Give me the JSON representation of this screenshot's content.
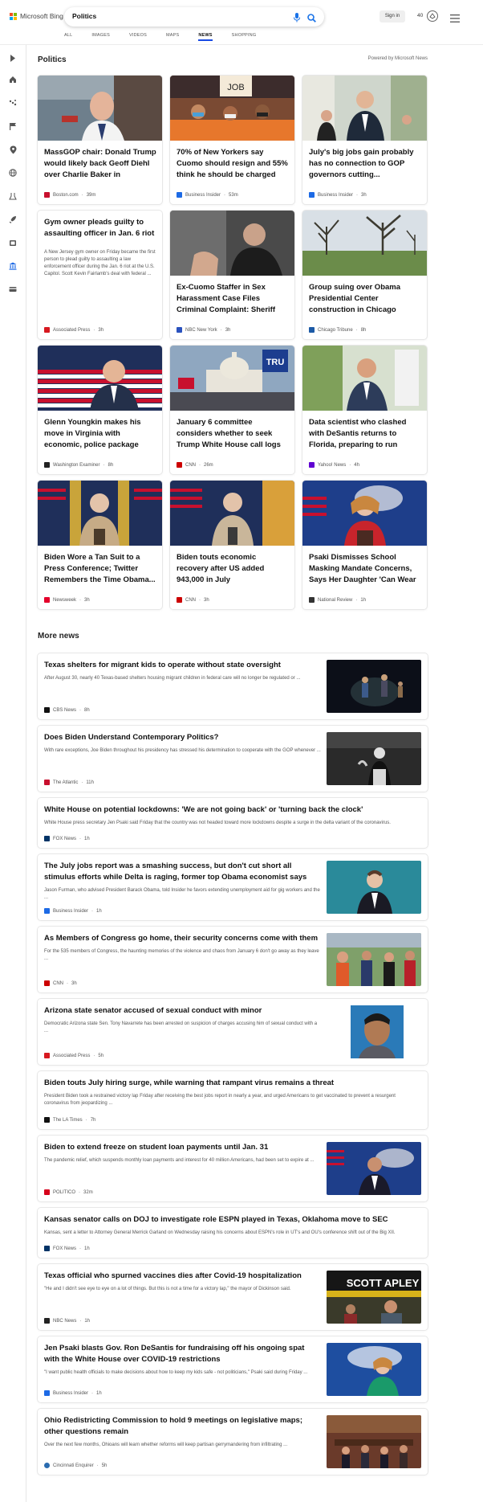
{
  "header": {
    "logo_text": "Microsoft Bing",
    "logo_colors": [
      "#f25022",
      "#7fba00",
      "#00a4ef",
      "#ffb900"
    ],
    "query": "Politics",
    "signin_label": "Sign in",
    "points": "40"
  },
  "tabs": [
    "ALL",
    "IMAGES",
    "VIDEOS",
    "MAPS",
    "NEWS",
    "SHOPPING"
  ],
  "active_tab": "NEWS",
  "sidebar_icons": [
    "chevron-right-icon",
    "home-icon",
    "sports-icon",
    "flag-icon",
    "location-pin-icon",
    "globe-icon",
    "science-icon",
    "rocket-icon",
    "entertainment-icon",
    "government-icon",
    "money-icon"
  ],
  "section": {
    "title": "Politics",
    "powered_by": "Powered by Microsoft News"
  },
  "cards": [
    {
      "title": "MassGOP chair: Donald Trump would likely back Geoff Diehl over Charlie Baker in governo...",
      "source": "Boston.com",
      "time": "39m",
      "src_color": "#c8102e",
      "has_image": true
    },
    {
      "title": "70% of New Yorkers say Cuomo should resign and 55% think he should be charged with a crim...",
      "source": "Business Insider",
      "time": "53m",
      "src_color": "#1d6ae5",
      "has_image": true
    },
    {
      "title": "July's big jobs gain probably has no connection to GOP governors cutting...",
      "source": "Business Insider",
      "time": "3h",
      "src_color": "#1d6ae5",
      "has_image": true
    },
    {
      "title": "Gym owner pleads guilty to assaulting officer in Jan. 6 riot",
      "snippet": "A New Jersey gym owner on Friday became the first person to plead guilty to assaulting a law enforcement officer during the Jan. 6 riot at the U.S. Capitol. Scott Kevin Fairlamb's deal with federal ...",
      "source": "Associated Press",
      "time": "3h",
      "src_color": "#d71920",
      "has_image": false
    },
    {
      "title": "Ex-Cuomo Staffer in Sex Harassment Case Files Criminal Complaint: Sheriff",
      "source": "NBC New York",
      "time": "3h",
      "src_color": "#2a52be",
      "has_image": true
    },
    {
      "title": "Group suing over Obama Presidential Center construction in Chicago dealt...",
      "source": "Chicago Tribune",
      "time": "8h",
      "src_color": "#1c5aa6",
      "has_image": true
    },
    {
      "title": "Glenn Youngkin makes his move in Virginia with economic, police package",
      "source": "Washington Examiner",
      "time": "8h",
      "src_color": "#222222",
      "has_image": true
    },
    {
      "title": "January 6 committee considers whether to seek Trump White House call logs as investigato...",
      "source": "CNN",
      "time": "26m",
      "src_color": "#cc0000",
      "has_image": true
    },
    {
      "title": "Data scientist who clashed with DeSantis returns to Florida, preparing to run against Matt...",
      "source": "Yahoo! News",
      "time": "4h",
      "src_color": "#6001d2",
      "has_image": true
    },
    {
      "title": "Biden Wore a Tan Suit to a Press Conference; Twitter Remembers the Time Obama...",
      "source": "Newsweek",
      "time": "3h",
      "src_color": "#e4002b",
      "has_image": true
    },
    {
      "title": "Biden touts economic recovery after US added 943,000 in July",
      "source": "CNN",
      "time": "3h",
      "src_color": "#cc0000",
      "has_image": true
    },
    {
      "title": "Psaki Dismisses School Masking Mandate Concerns, Says Her Daughter 'Can Wear ...",
      "source": "National Review",
      "time": "1h",
      "src_color": "#333333",
      "has_image": true
    }
  ],
  "more_news_title": "More news",
  "news": [
    {
      "title": "Texas shelters for migrant kids to operate without state oversight",
      "snippet": "After August 30, nearly 40 Texas-based shelters housing migrant children in federal care will no longer be regulated or ...",
      "source": "CBS News",
      "time": "8h",
      "src_color": "#111111",
      "thumb": "night"
    },
    {
      "title": "Does Biden Understand Contemporary Politics?",
      "snippet": "With rare exceptions, Joe Biden throughout his presidency has stressed his determination to cooperate with the GOP whenever ...",
      "source": "The Atlantic",
      "time": "11h",
      "src_color": "#c8102e",
      "thumb": "bw"
    },
    {
      "title": "White House on potential lockdowns: 'We are not going back' or 'turning back the clock'",
      "snippet": "White House press secretary Jen Psaki said Friday that the country was not headed toward more lockdowns despite a surge in the delta variant of the coronavirus.",
      "source": "FOX News",
      "time": "1h",
      "src_color": "#003366",
      "thumb": ""
    },
    {
      "title": "The July jobs report was a smashing success, but don't cut short all stimulus efforts while Delta is raging, former top Obama economist says",
      "snippet": "Jason Furman, who advised President Barack Obama, told Insider he favors extending unemployment aid for gig workers and the ...",
      "source": "Business Insider",
      "time": "1h",
      "src_color": "#1d6ae5",
      "thumb": "teal"
    },
    {
      "title": "As Members of Congress go home, their security concerns come with them",
      "snippet": "For the 535 members of Congress, the haunting memories of the violence and chaos from January 6 don't go away as they leave ...",
      "source": "CNN",
      "time": "3h",
      "src_color": "#cc0000",
      "thumb": "crowd"
    },
    {
      "title": "Arizona state senator accused of sexual conduct with minor",
      "snippet": "Democratic Arizona state Sen. Tony Navarrete has been arrested on suspicion of charges accusing him of sexual conduct with a ...",
      "source": "Associated Press",
      "time": "5h",
      "src_color": "#d71920",
      "thumb": "mug"
    },
    {
      "title": "Biden touts July hiring surge, while warning that rampant virus remains a threat",
      "snippet": "President Biden took a restrained victory lap Friday after receiving the best jobs report in nearly a year, and urged Americans to get vaccinated to prevent a resurgent coronavirus from jeopardizing ...",
      "source": "The LA Times",
      "time": "7h",
      "src_color": "#111111",
      "thumb": ""
    },
    {
      "title": "Biden to extend freeze on student loan payments until Jan. 31",
      "snippet": "The pandemic relief, which suspends monthly loan payments and interest for 40 million Americans, had been set to expire at ...",
      "source": "POLITICO",
      "time": "32m",
      "src_color": "#d6001c",
      "thumb": "podium"
    },
    {
      "title": "Kansas senator calls on DOJ to investigate role ESPN played in Texas, Oklahoma move to SEC",
      "snippet": "Kansas, sent a letter to Attorney General Merrick Garland on Wednesday raising his concerns about ESPN's role in UT's and OU's conference shift out of the Big XII.",
      "source": "FOX News",
      "time": "1h",
      "src_color": "#003366",
      "thumb": ""
    },
    {
      "title": "Texas official who spurned vaccines dies after Covid-19 hospitalization",
      "snippet": "\"He and I didn't see eye to eye on a lot of things. But this is not a time for a victory lap,\" the mayor of Dickinson said.",
      "source": "NBC News",
      "time": "1h",
      "src_color": "#222222",
      "thumb": "sign",
      "sign_text": "SCOTT APLEY"
    },
    {
      "title": "Jen Psaki blasts Gov. Ron DeSantis for fundraising off his ongoing spat with the White House over COVID-19 restrictions",
      "snippet": "\"I want public health officials to make decisions about how to keep my kids safe - not politicians,\" Psaki said during Friday ...",
      "source": "Business Insider",
      "time": "1h",
      "src_color": "#1d6ae5",
      "thumb": "psaki"
    },
    {
      "title": "Ohio Redistricting Commission to hold 9 meetings on legislative maps; other questions remain",
      "snippet": "Over the next few months, Ohioans will learn whether reforms will keep partisan gerrymandering from infiltrating ...",
      "source": "Cincinnati Enquirer",
      "time": "5h",
      "src_color": "#2b6cb0",
      "thumb": "room"
    }
  ]
}
